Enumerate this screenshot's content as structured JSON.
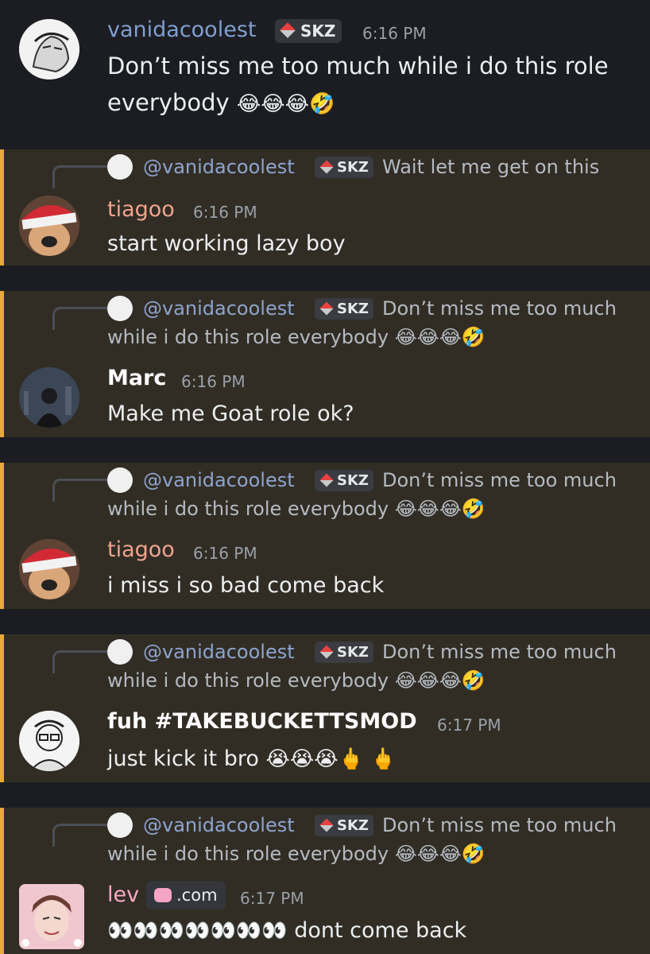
{
  "messages": [
    {
      "author": "vanidacoolest",
      "tag": "SKZ",
      "time": "6:16 PM",
      "line1": "Don’t miss me too much while i do this role",
      "line2": "everybody",
      "emojis": "😂😂😂🤣"
    },
    {
      "reply_mention": "@vanidacoolest",
      "reply_tag": "SKZ",
      "reply_text": "Wait let me get on this",
      "author": "tiagoo",
      "time": "6:16 PM",
      "text": "start working lazy boy"
    },
    {
      "reply_mention": "@vanidacoolest",
      "reply_tag": "SKZ",
      "reply_text": "Don’t miss me too much",
      "reply_text2": "while i do this role  everybody",
      "reply_emojis": "😂😂😂🤣",
      "author": "Marc",
      "time": "6:16 PM",
      "text": "Make me Goat role ok?"
    },
    {
      "reply_mention": "@vanidacoolest",
      "reply_tag": "SKZ",
      "reply_text": "Don’t miss me too much",
      "reply_text2": "while i do this role  everybody",
      "reply_emojis": "😂😂😂🤣",
      "author": "tiagoo",
      "time": "6:16 PM",
      "text": "i miss i so bad come back"
    },
    {
      "reply_mention": "@vanidacoolest",
      "reply_tag": "SKZ",
      "reply_text": "Don’t miss me too much",
      "reply_text2": "while i do this role  everybody",
      "reply_emojis": "😂😂😂🤣",
      "author": "fuh #TAKEBUCKETTSMOD",
      "time": "6:17 PM",
      "text": "just kick it bro",
      "emojis": "😭😭😭🖕 🖕"
    },
    {
      "reply_mention": "@vanidacoolest",
      "reply_tag": "SKZ",
      "reply_text": "Don’t miss me too much",
      "reply_text2": "while i do this role  everybody",
      "reply_emojis": "😂😂😂🤣",
      "author": "lev",
      "badge": ".com",
      "time": "6:17 PM",
      "emojis": "👀👀👀👀👀👀👀",
      "text": "dont come back"
    }
  ],
  "colors": {
    "background": "#1c1d22",
    "mention_bg": "#312d25",
    "mention_bar": "#e8a83a",
    "vanida_name": "#7f9fd0",
    "tiagoo_name": "#f0a38d",
    "white_name": "#ffffff",
    "lev_name": "#f7a8c4"
  }
}
